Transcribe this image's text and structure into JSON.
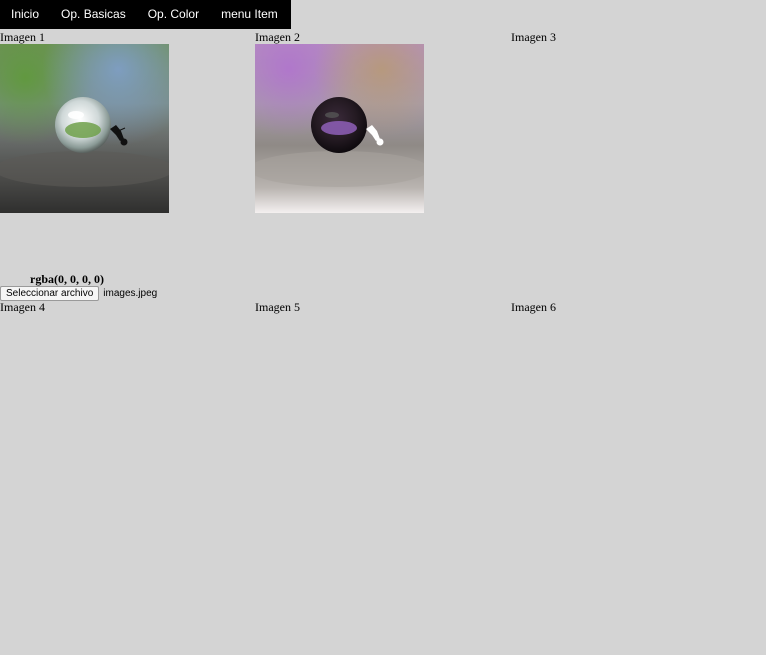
{
  "menu": {
    "items": [
      {
        "label": "Inicio"
      },
      {
        "label": "Op. Basicas"
      },
      {
        "label": "Op. Color"
      },
      {
        "label": "menu Item"
      }
    ]
  },
  "gallery": {
    "labels": {
      "img1": "Imagen 1",
      "img2": "Imagen 2",
      "img3": "Imagen 3",
      "img4": "Imagen 4",
      "img5": "Imagen 5",
      "img6": "Imagen 6"
    }
  },
  "color_readout": "rgba(0, 0, 0, 0)",
  "file_input": {
    "button_label": "Seleccionar archivo",
    "file_name": "images.jpeg"
  }
}
